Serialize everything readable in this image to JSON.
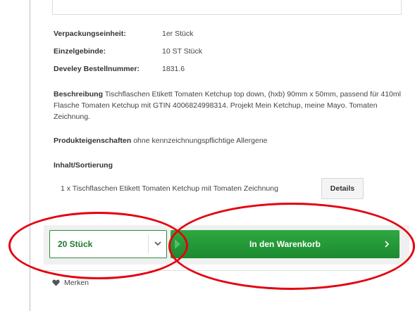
{
  "properties": [
    {
      "label": "Verpackungseinheit:",
      "value": "1er Stück"
    },
    {
      "label": "Einzelgebinde:",
      "value": "10 ST Stück"
    },
    {
      "label": "Develey Bestellnummer:",
      "value": "1831.6"
    }
  ],
  "description": {
    "label": "Beschreibung",
    "text": "Tischflaschen Etikett Tomaten Ketchup top down, (hxb) 90mm x 50mm, passend für 410ml Flasche Tomaten Ketchup mit GTIN 4006824998314. Projekt Mein Ketchup, meine Mayo. Tomaten Zeichnung."
  },
  "product_properties": {
    "label": "Produkteigenschaften",
    "text": "ohne kennzeichnungspflichtige Allergene"
  },
  "contents": {
    "title": "Inhalt/Sortierung",
    "item": "1 x Tischflaschen Etikett Tomaten Ketchup mit Tomaten Zeichnung",
    "details_label": "Details"
  },
  "buy": {
    "quantity": "20 Stück",
    "cart_label": "In den Warenkorb"
  },
  "remember_label": "Merken",
  "icons": {
    "quantity": "chevron-down-icon",
    "cart": "chevron-right-icon",
    "remember": "heart-icon"
  },
  "colors": {
    "accent_green": "#1b8a2f",
    "highlight_red": "#e4000f"
  }
}
